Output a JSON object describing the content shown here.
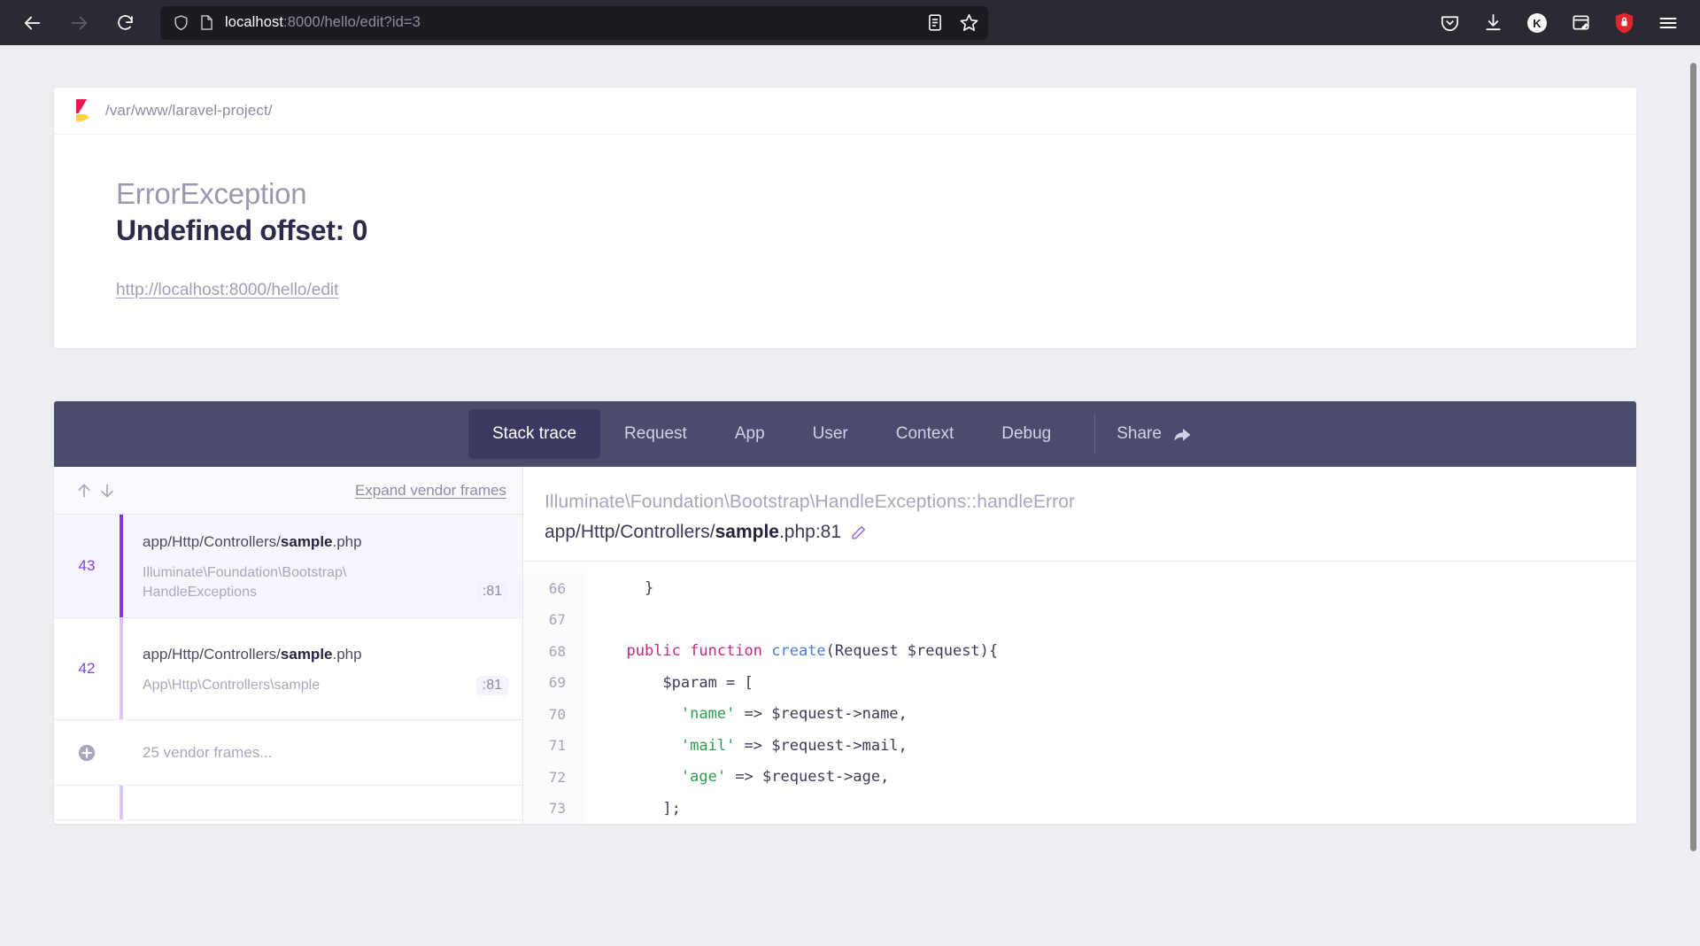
{
  "browser": {
    "back_label": "back-arrow",
    "forward_label": "forward-arrow",
    "reload_label": "reload",
    "url_host": "localhost",
    "url_rest": ":8000/hello/edit?id=3",
    "url_full": "localhost:8000/hello/edit?id=3",
    "icons": {
      "shield": "shield-icon",
      "page": "page-icon",
      "reader": "reader-mode-icon",
      "bookmark": "bookmark-star-icon",
      "pocket": "pocket-icon",
      "downloads": "downloads-icon",
      "account": "kagi-account-icon",
      "screenshot": "screenshot-icon",
      "password": "password-manager-icon",
      "menu": "hamburger-menu-icon"
    }
  },
  "error_card": {
    "project_path": "/var/www/laravel-project/",
    "exception_class": "ErrorException",
    "exception_message": "Undefined offset: 0",
    "request_url": "http://localhost:8000/hello/edit"
  },
  "tabs": [
    {
      "label": "Stack trace",
      "active": true
    },
    {
      "label": "Request",
      "active": false
    },
    {
      "label": "App",
      "active": false
    },
    {
      "label": "User",
      "active": false
    },
    {
      "label": "Context",
      "active": false
    },
    {
      "label": "Debug",
      "active": false
    }
  ],
  "share": {
    "label": "Share"
  },
  "frames_panel": {
    "expand_vendor_label": "Expand vendor frames",
    "sort_up": "arrow-up-icon",
    "sort_down": "arrow-down-icon",
    "frames": [
      {
        "number": "43",
        "file_path": "app/Http/Controllers/",
        "file_name": "sample",
        "file_ext": ".php",
        "class": "Illuminate\\Foundation\\Bootstrap\\\nHandleExceptions",
        "line": ":81",
        "selected": true
      },
      {
        "number": "42",
        "file_path": "app/Http/Controllers/",
        "file_name": "sample",
        "file_ext": ".php",
        "class": "App\\Http\\Controllers\\sample",
        "line": ":81",
        "selected": false
      }
    ],
    "vendor_summary": "25 vendor frames..."
  },
  "code_panel": {
    "header_class": "Illuminate\\Foundation\\Bootstrap\\HandleExceptions::handleError",
    "header_file_path": "app/Http/Controllers/",
    "header_file_name": "sample",
    "header_file_suffix": ".php:81",
    "edit_icon": "pencil-edit-icon",
    "lines": [
      {
        "n": "66",
        "segments": [
          {
            "t": "    }",
            "c": ""
          }
        ]
      },
      {
        "n": "67",
        "segments": [
          {
            "t": "",
            "c": ""
          }
        ]
      },
      {
        "n": "68",
        "segments": [
          {
            "t": "  ",
            "c": ""
          },
          {
            "t": "public function ",
            "c": "kw"
          },
          {
            "t": "create",
            "c": "fn"
          },
          {
            "t": "(Request $request){",
            "c": ""
          }
        ]
      },
      {
        "n": "69",
        "segments": [
          {
            "t": "      $param = [",
            "c": ""
          }
        ]
      },
      {
        "n": "70",
        "segments": [
          {
            "t": "        ",
            "c": ""
          },
          {
            "t": "'name'",
            "c": "str"
          },
          {
            "t": " => $request->name,",
            "c": ""
          }
        ]
      },
      {
        "n": "71",
        "segments": [
          {
            "t": "        ",
            "c": ""
          },
          {
            "t": "'mail'",
            "c": "str"
          },
          {
            "t": " => $request->mail,",
            "c": ""
          }
        ]
      },
      {
        "n": "72",
        "segments": [
          {
            "t": "        ",
            "c": ""
          },
          {
            "t": "'age'",
            "c": "str"
          },
          {
            "t": " => $request->age,",
            "c": ""
          }
        ]
      },
      {
        "n": "73",
        "segments": [
          {
            "t": "      ];",
            "c": ""
          }
        ]
      }
    ]
  },
  "colors": {
    "chrome_bg": "#2b2a33",
    "urlbar_bg": "#1c1b22",
    "page_bg": "#eceef3",
    "tabbar_bg": "#4c4a6d",
    "tab_active_bg": "#3b3961",
    "accent_purple": "#8b2fe8",
    "flare_red": "#e63946",
    "flare_yellow": "#ffd23f"
  }
}
